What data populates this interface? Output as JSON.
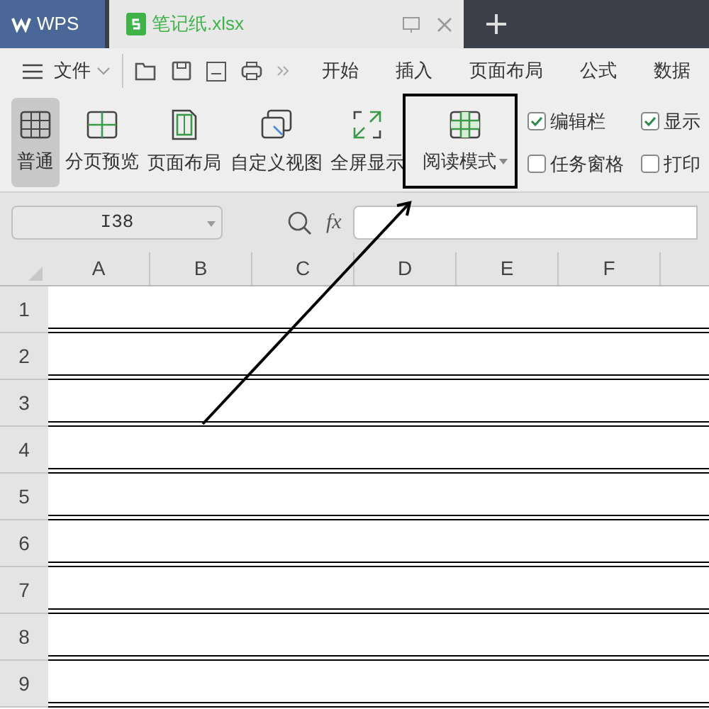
{
  "tabs": [
    {
      "label": "WPS",
      "kind": "home",
      "selected": false
    },
    {
      "label": "笔记纸.xlsx",
      "kind": "file",
      "selected": true
    }
  ],
  "menu": {
    "file_label": "文件",
    "tabs": [
      "开始",
      "插入",
      "页面布局",
      "公式",
      "数据"
    ]
  },
  "view_buttons": [
    {
      "label": "普通",
      "selected": true,
      "dropdown": false
    },
    {
      "label": "分页预览",
      "selected": false,
      "dropdown": false
    },
    {
      "label": "页面布局",
      "selected": false,
      "dropdown": false
    },
    {
      "label": "自定义视图",
      "selected": false,
      "dropdown": false
    },
    {
      "label": "全屏显示",
      "selected": false,
      "dropdown": false
    },
    {
      "label": "阅读模式",
      "selected": false,
      "dropdown": true
    }
  ],
  "checkboxes": [
    {
      "label": "编辑栏",
      "checked": true
    },
    {
      "label": "任务窗格",
      "checked": false
    },
    {
      "label": "显示",
      "checked": true
    },
    {
      "label": "打印",
      "checked": false
    }
  ],
  "name_box": {
    "value": "I38"
  },
  "formula_bar": {
    "fx_label": "fx"
  },
  "columns": [
    "A",
    "B",
    "C",
    "D",
    "E",
    "F"
  ],
  "rows": [
    "1",
    "2",
    "3",
    "4",
    "5",
    "6",
    "7",
    "8",
    "9"
  ]
}
